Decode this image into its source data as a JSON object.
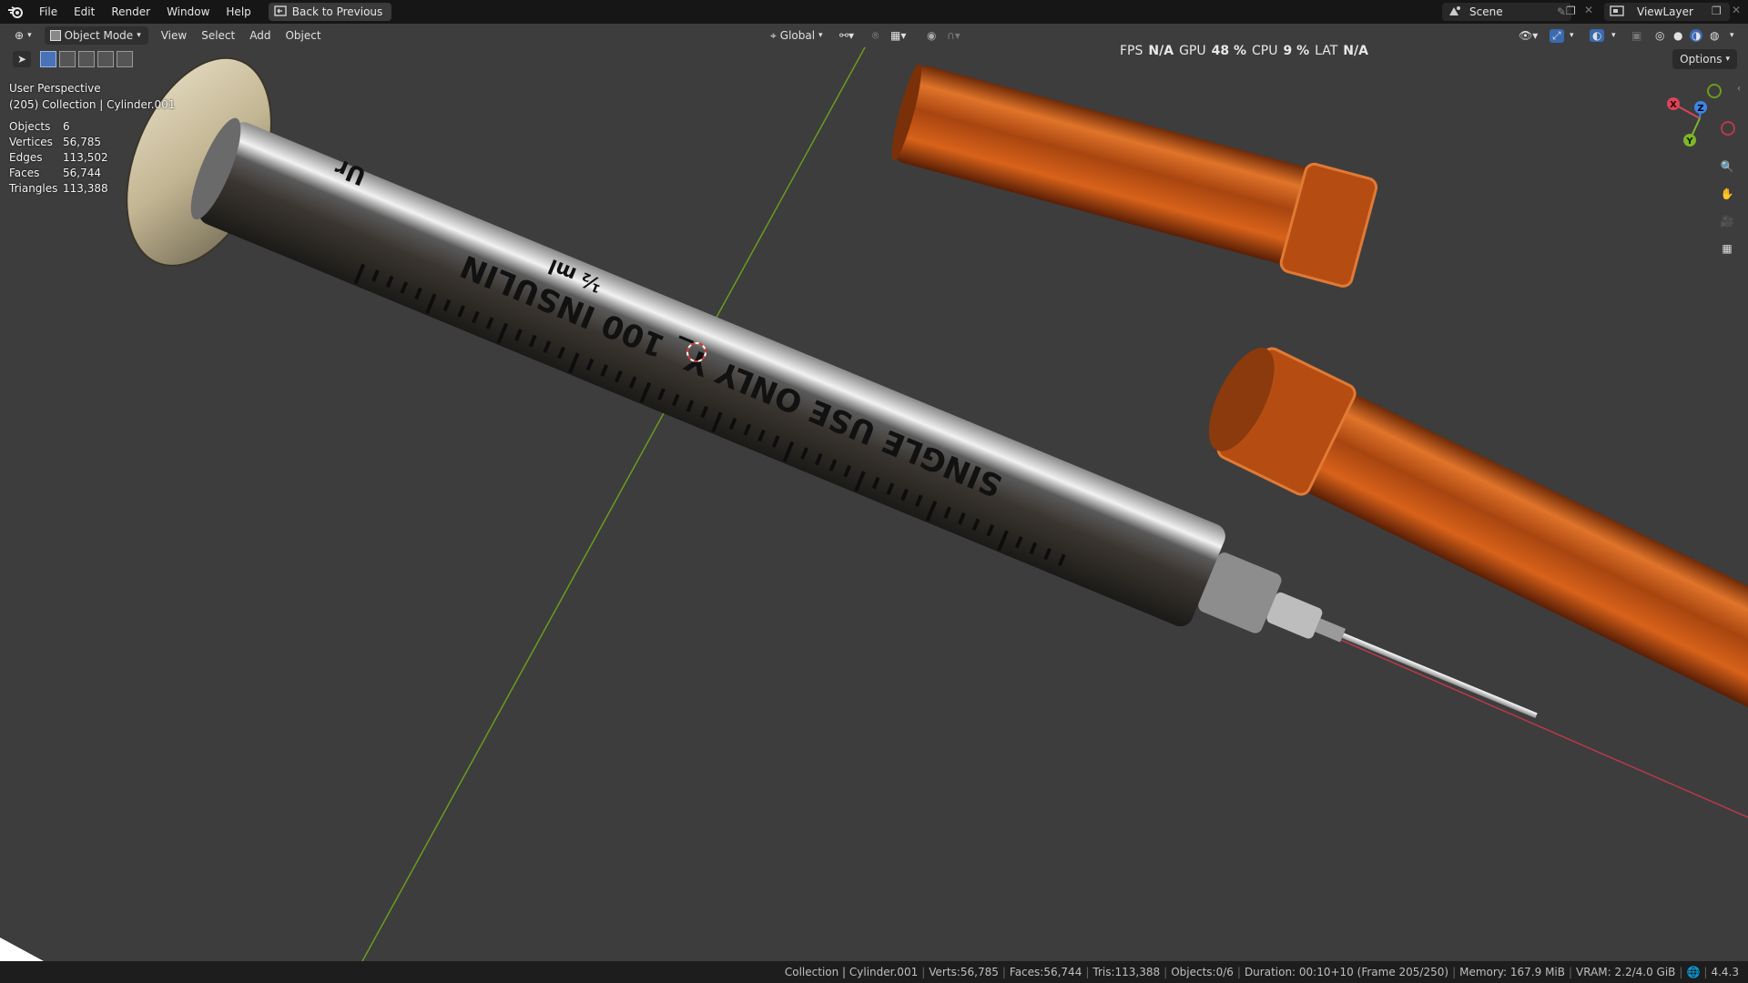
{
  "menu": {
    "items": [
      "File",
      "Edit",
      "Render",
      "Window",
      "Help"
    ],
    "back_button": "Back to Previous"
  },
  "workspace": {
    "scene_label": "Scene",
    "view_layer_label": "ViewLayer"
  },
  "viewport_header": {
    "mode": "Object Mode",
    "menus": [
      "View",
      "Select",
      "Add",
      "Object"
    ],
    "orientation": "Global"
  },
  "hud": {
    "fps_label": "FPS",
    "fps_value": "N/A",
    "gpu_label": "GPU",
    "gpu_value": "48 %",
    "cpu_label": "CPU",
    "cpu_value": "9 %",
    "lat_label": "LAT",
    "lat_value": "N/A"
  },
  "overlay": {
    "view_name": "User Perspective",
    "collection_line": "(205) Collection | Cylinder.001"
  },
  "stats": [
    {
      "label": "Objects",
      "value": "6"
    },
    {
      "label": "Vertices",
      "value": "56,785"
    },
    {
      "label": "Edges",
      "value": "113,502"
    },
    {
      "label": "Faces",
      "value": "56,744"
    },
    {
      "label": "Triangles",
      "value": "113,388"
    }
  ],
  "options_label": "Options",
  "syringe_labels": {
    "text_main": "SINGLE USE ONLY Y_ 100 INSULIN",
    "text_unit": "½ ml",
    "text_brand": "Ur"
  },
  "gizmo": {
    "x": "X",
    "y": "Y",
    "z": "Z"
  },
  "status_bar": {
    "collection": "Collection | Cylinder.001",
    "verts": "Verts:56,785",
    "faces": "Faces:56,744",
    "tris": "Tris:113,388",
    "objects": "Objects:0/6",
    "duration": "Duration: 00:10+10 (Frame 205/250)",
    "memory": "Memory: 167.9 MiB",
    "vram": "VRAM: 2.2/4.0 GiB",
    "version": "4.4.3"
  },
  "colors": {
    "viewport_bg": "#3d3d3d",
    "x_axis": "#b83a4a",
    "y_axis": "#6b9b1f",
    "cap_orange": "#c2520f"
  }
}
